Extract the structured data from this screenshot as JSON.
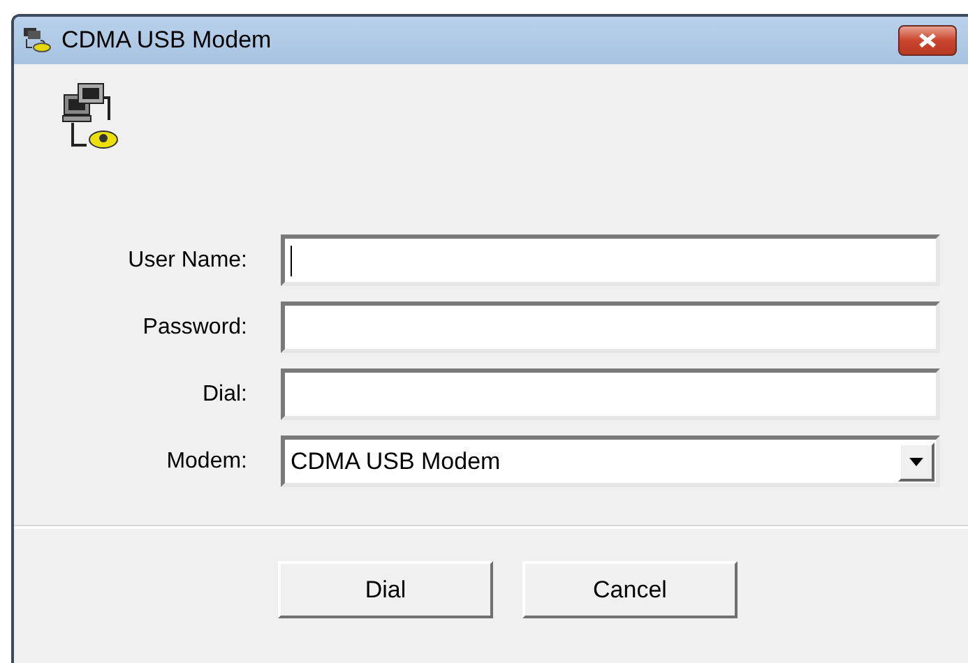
{
  "window": {
    "title": "CDMA USB Modem"
  },
  "fields": [
    {
      "kind": "text",
      "label": "User Name:",
      "focused": true
    },
    {
      "kind": "text",
      "label": "Password:",
      "focused": false
    },
    {
      "kind": "text",
      "label": "Dial:",
      "focused": false
    },
    {
      "kind": "select",
      "label": "Modem:",
      "value": "CDMA USB Modem",
      "focused": false
    }
  ],
  "buttons": [
    "Dial",
    "Cancel"
  ]
}
